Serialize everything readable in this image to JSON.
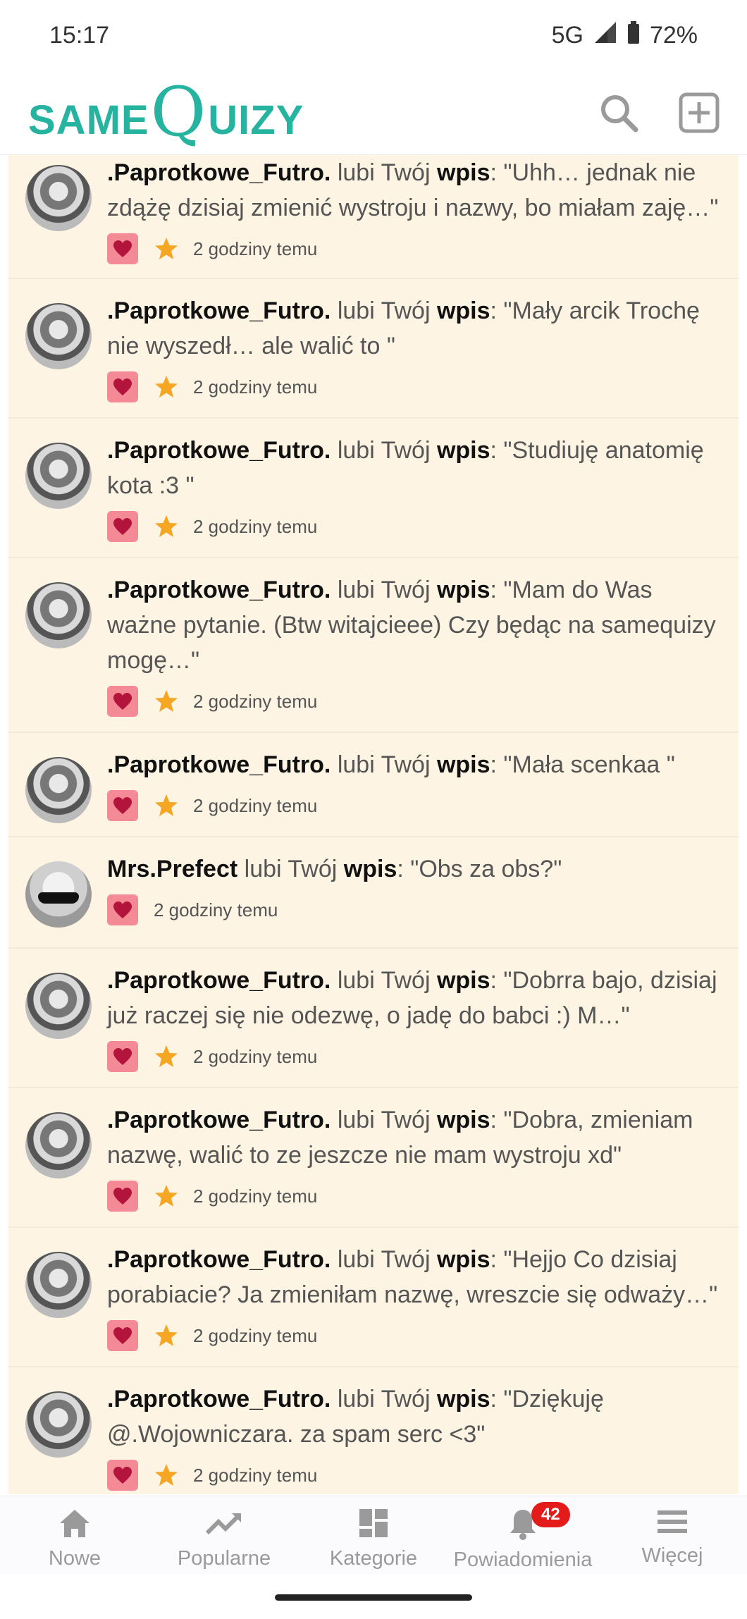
{
  "status": {
    "time": "15:17",
    "network": "5G",
    "battery": "72%"
  },
  "header": {
    "logo_same": "SAME",
    "logo_q": "Q",
    "logo_uizy": "UIZY"
  },
  "notifications": [
    {
      "user": ".Paprotkowe_Futro.",
      "verb": "lubi Twój",
      "object": "wpis",
      "quote": ": \"Uhh… jednak nie zdążę dzisiaj zmienić wystroju i nazwy, bo miałam zaję…\"",
      "time": "2 godziny temu",
      "star": true,
      "avatar": "futro"
    },
    {
      "user": ".Paprotkowe_Futro.",
      "verb": "lubi Twój",
      "object": "wpis",
      "quote": ": \"Mały arcik Trochę nie wyszedł… ale walić to \"",
      "time": "2 godziny temu",
      "star": true,
      "avatar": "futro"
    },
    {
      "user": ".Paprotkowe_Futro.",
      "verb": "lubi Twój",
      "object": "wpis",
      "quote": ": \"Studiuję anatomię kota :3 \"",
      "time": "2 godziny temu",
      "star": true,
      "avatar": "futro"
    },
    {
      "user": ".Paprotkowe_Futro.",
      "verb": "lubi Twój",
      "object": "wpis",
      "quote": ": \"Mam do Was ważne pytanie. (Btw witajcieee) Czy będąc na samequizy mogę…\"",
      "time": "2 godziny temu",
      "star": true,
      "avatar": "futro"
    },
    {
      "user": ".Paprotkowe_Futro.",
      "verb": "lubi Twój",
      "object": "wpis",
      "quote": ": \"Mała scenkaa \"",
      "time": "2 godziny temu",
      "star": true,
      "avatar": "futro"
    },
    {
      "user": "Mrs.Prefect",
      "verb": "lubi Twój",
      "object": "wpis",
      "quote": ": \"Obs za obs?\"",
      "time": "2 godziny temu",
      "star": false,
      "avatar": "prefect"
    },
    {
      "user": ".Paprotkowe_Futro.",
      "verb": "lubi Twój",
      "object": "wpis",
      "quote": ": \"Dobrra bajo, dzisiaj już raczej się nie odezwę, o jadę do babci :) M…\"",
      "time": "2 godziny temu",
      "star": true,
      "avatar": "futro"
    },
    {
      "user": ".Paprotkowe_Futro.",
      "verb": "lubi Twój",
      "object": "wpis",
      "quote": ": \"Dobra, zmieniam nazwę, walić to ze jeszcze nie mam wystroju xd\"",
      "time": "2 godziny temu",
      "star": true,
      "avatar": "futro"
    },
    {
      "user": ".Paprotkowe_Futro.",
      "verb": "lubi Twój",
      "object": "wpis",
      "quote": ": \"Hejjo Co dzisiaj porabiacie? Ja zmieniłam nazwę, wreszcie się odważy…\"",
      "time": "2 godziny temu",
      "star": true,
      "avatar": "futro"
    },
    {
      "user": ".Paprotkowe_Futro.",
      "verb": "lubi Twój",
      "object": "wpis",
      "quote": ": \"Dziękuję @.Wojowniczara. za spam serc <3\"",
      "time": "2 godziny temu",
      "star": true,
      "avatar": "futro"
    }
  ],
  "nav": [
    {
      "label": "Nowe",
      "icon": "home-icon"
    },
    {
      "label": "Popularne",
      "icon": "trending-icon"
    },
    {
      "label": "Kategorie",
      "icon": "grid-icon"
    },
    {
      "label": "Powiadomienia",
      "icon": "bell-icon",
      "badge": "42"
    },
    {
      "label": "Więcej",
      "icon": "menu-icon"
    }
  ],
  "colors": {
    "brand": "#26b3a0",
    "item_bg": "#fdf4e3",
    "heart": "#f58a97",
    "star": "#f5a623",
    "badge": "#e31b1b"
  }
}
